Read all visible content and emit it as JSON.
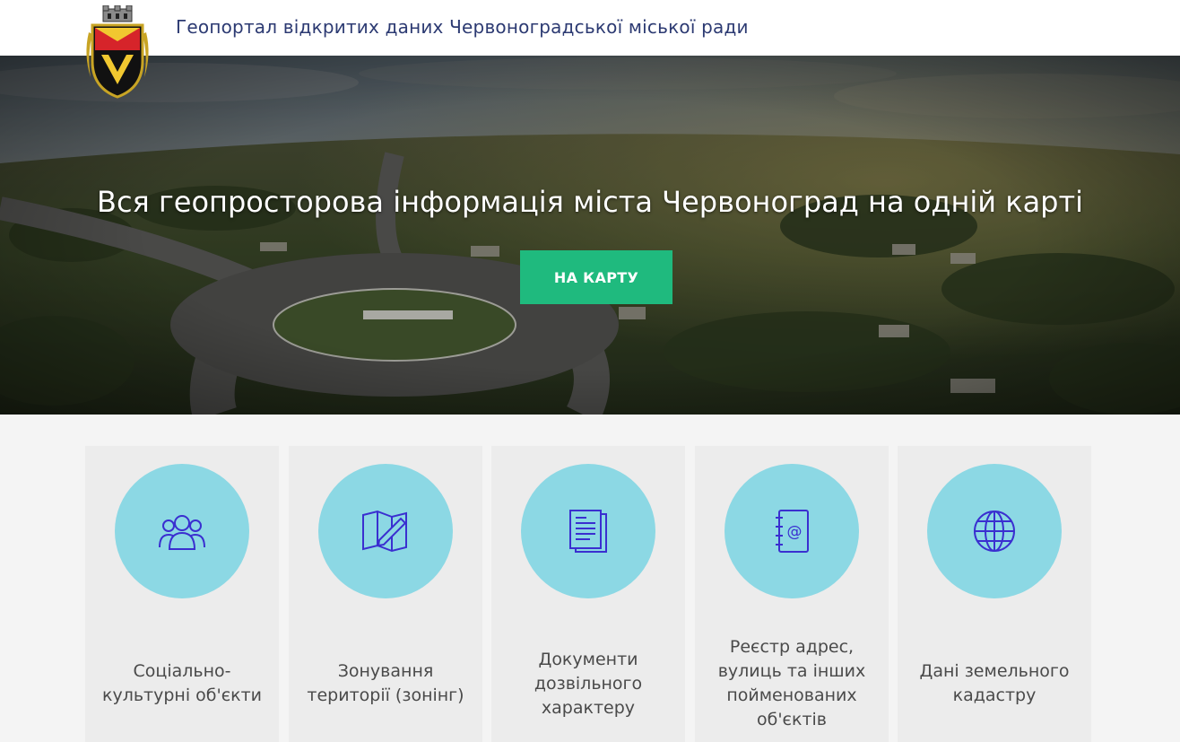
{
  "header": {
    "title": "Геопортал відкритих даних Червоноградської міської ради",
    "logo_icon": "coat-of-arms-icon"
  },
  "hero": {
    "headline": "Вся геопросторова інформація міста Червоноград на одній карті",
    "button_label": "НА КАРТУ",
    "button_color": "#1fba7e"
  },
  "cards": [
    {
      "label": "Соціально-культурні об'єкти",
      "icon": "users-icon"
    },
    {
      "label": "Зонування території (зонінг)",
      "icon": "map-edit-icon"
    },
    {
      "label": "Документи дозвільного характеру",
      "icon": "documents-icon"
    },
    {
      "label": "Реєстр адрес, вулиць та інших пойменованих об'єктів",
      "icon": "address-book-icon"
    },
    {
      "label": "Дані земельного кадастру",
      "icon": "globe-icon"
    }
  ],
  "colors": {
    "title": "#2c3a72",
    "circle": "#8cd8e4",
    "icon_stroke": "#3a2fd0",
    "card_bg": "#ececec"
  }
}
